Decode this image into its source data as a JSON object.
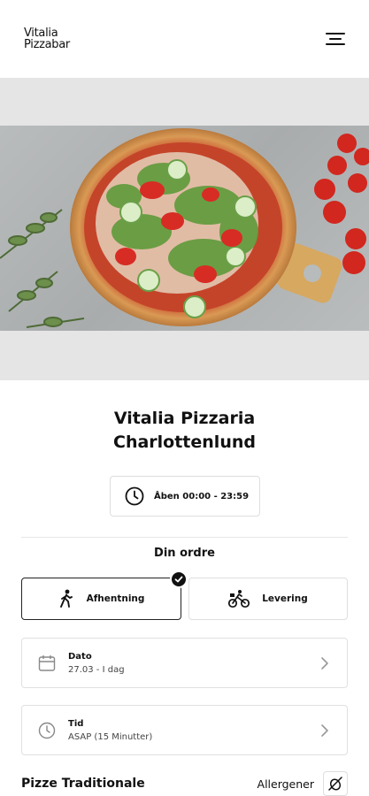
{
  "header": {
    "logo_line1": "Vitalia",
    "logo_line2": "Pizzabar",
    "menu_icon": "hamburger-menu-icon"
  },
  "hero": {
    "image": "pizza-photo"
  },
  "restaurant": {
    "name_line1": "Vitalia Pizzaria",
    "name_line2": "Charlottenlund",
    "hours": "Åben 00:00 - 23:59",
    "hours_icon": "clock-icon"
  },
  "order": {
    "title": "Din ordre",
    "pickup_label": "Afhentning",
    "pickup_icon": "walking-person-icon",
    "delivery_label": "Levering",
    "delivery_icon": "bicycle-delivery-icon",
    "selected": "pickup"
  },
  "date_field": {
    "label": "Dato",
    "value": "27.03 - I dag",
    "icon": "calendar-icon"
  },
  "time_field": {
    "label": "Tid",
    "value": "ASAP (15 Minutter)",
    "icon": "clock-icon"
  },
  "menu_section": {
    "title": "Pizze Traditionale",
    "allergens_label": "Allergener",
    "allergens_icon": "no-allergen-icon"
  },
  "colors": {
    "text": "#111111",
    "border": "#dedede",
    "hero_bg": "#e5e5e5"
  }
}
